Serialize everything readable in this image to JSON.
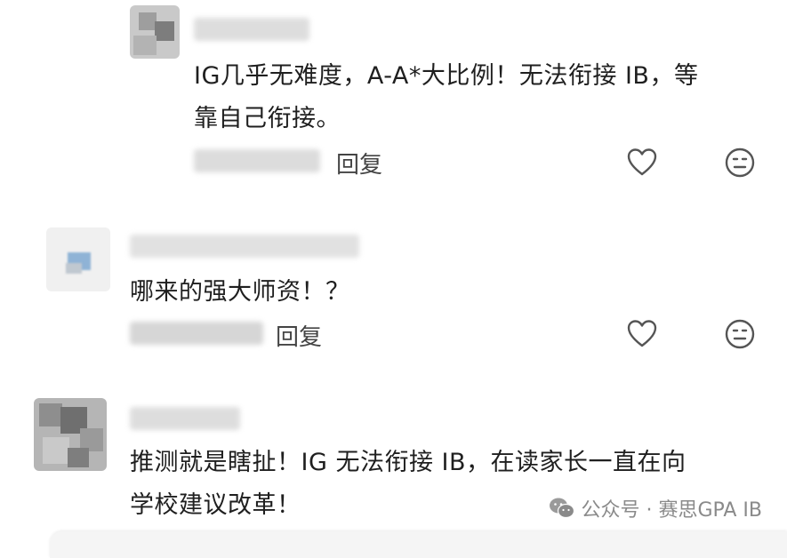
{
  "comments": [
    {
      "text": "IG几乎无难度，A-A*大比例！无法衔接 IB，等\n靠自己衔接。",
      "reply_label": "回复"
    },
    {
      "text": "哪来的强大师资！？",
      "reply_label": "回复"
    },
    {
      "text": "推测就是瞎扯！IG 无法衔接 IB，在读家长一直在向\n学校建议改革！"
    }
  ],
  "watermark": {
    "text": "公众号 · 赛思GPA IB",
    "icon": "wechat-icon"
  },
  "icons": {
    "like": "heart-icon",
    "react": "emoji-icon"
  },
  "colors": {
    "text": "#1f1f1f",
    "icon": "#555555",
    "watermark": "#8a8a8a"
  }
}
